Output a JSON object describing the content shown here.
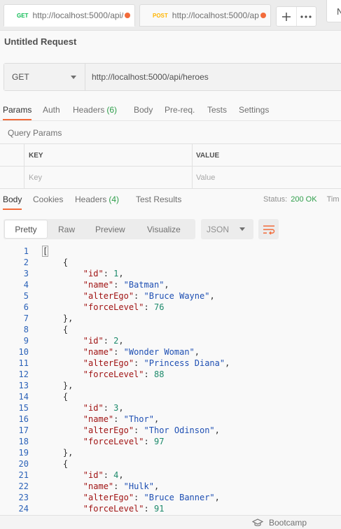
{
  "tabs": [
    {
      "method": "GET",
      "url": "http://localhost:5000/api/...",
      "modified": true
    },
    {
      "method": "POST",
      "url": "http://localhost:5000/ap...",
      "modified": true
    }
  ],
  "tab_actions": {
    "new_tab_icon": "plus-icon",
    "more_icon": "ellipsis-icon"
  },
  "environment_label": "N",
  "request": {
    "title": "Untitled Request",
    "method": "GET",
    "url": "http://localhost:5000/api/heroes"
  },
  "request_tabs": [
    {
      "label": "Params",
      "active": true
    },
    {
      "label": "Auth"
    },
    {
      "label": "Headers",
      "count": "(6)"
    },
    {
      "label": "Body"
    },
    {
      "label": "Pre-req."
    },
    {
      "label": "Tests"
    },
    {
      "label": "Settings"
    }
  ],
  "query_params": {
    "title": "Query Params",
    "columns": [
      "KEY",
      "VALUE"
    ],
    "placeholders": [
      "Key",
      "Value"
    ]
  },
  "response_tabs": [
    {
      "label": "Body",
      "active": true
    },
    {
      "label": "Cookies"
    },
    {
      "label": "Headers",
      "count": "(4)"
    },
    {
      "label": "Test Results"
    }
  ],
  "response_status": {
    "label": "Status:",
    "value": "200 OK",
    "time_label": "Tim"
  },
  "body_view": {
    "modes": [
      "Pretty",
      "Raw",
      "Preview",
      "Visualize"
    ],
    "active_mode": "Pretty",
    "format": "JSON",
    "wrap_icon": "wrap-lines-icon"
  },
  "code_lines": [
    "[",
    "    {",
    "        \"id\": 1,",
    "        \"name\": \"Batman\",",
    "        \"alterEgo\": \"Bruce Wayne\",",
    "        \"forceLevel\": 76",
    "    },",
    "    {",
    "        \"id\": 2,",
    "        \"name\": \"Wonder Woman\",",
    "        \"alterEgo\": \"Princess Diana\",",
    "        \"forceLevel\": 88",
    "    },",
    "    {",
    "        \"id\": 3,",
    "        \"name\": \"Thor\",",
    "        \"alterEgo\": \"Thor Odinson\",",
    "        \"forceLevel\": 97",
    "    },",
    "    {",
    "        \"id\": 4,",
    "        \"name\": \"Hulk\",",
    "        \"alterEgo\": \"Bruce Banner\",",
    "        \"forceLevel\": 91"
  ],
  "statusbar": {
    "bootcamp_label": "Bootcamp",
    "bootcamp_icon": "graduation-cap-icon"
  },
  "colors": {
    "accent": "#f26b3a",
    "get": "#0cbb52",
    "post": "#ffb400",
    "ok": "#2e9e4a"
  }
}
